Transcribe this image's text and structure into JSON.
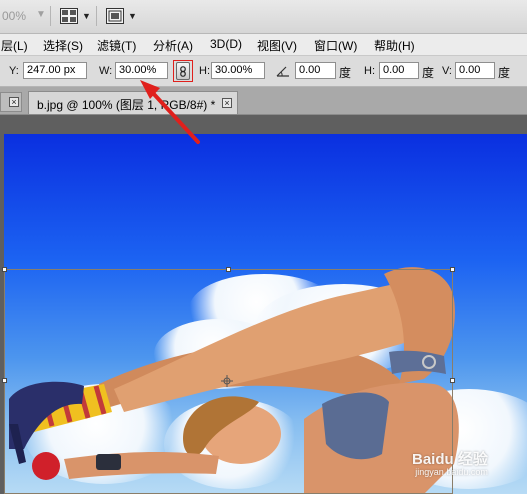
{
  "toolbar": {
    "zoom_value": "00%",
    "arrange_icon": "arrange-documents-icon",
    "screen_mode_icon": "screen-mode-icon"
  },
  "menu": {
    "items": [
      "层(L)",
      "选择(S)",
      "滤镜(T)",
      "分析(A)",
      "3D(D)",
      "视图(V)",
      "窗口(W)",
      "帮助(H)"
    ]
  },
  "options": {
    "y_label": "Y:",
    "y_value": "247.00 px",
    "w_label": "W:",
    "w_value": "30.00%",
    "h_label": "H:",
    "h_value": "30.00%",
    "angle_value": "0.00",
    "angle_unit": "度",
    "hskew_label": "H:",
    "hskew_value": "0.00",
    "hskew_unit": "度",
    "vskew_label": "V:",
    "vskew_value": "0.00",
    "vskew_unit": "度",
    "link_icon": "link-aspect-ratio-icon"
  },
  "tabs": {
    "active_title": "b.jpg @ 100% (图层 1, RGB/8#) *"
  },
  "annotation": {
    "arrow_color": "#e0201c",
    "highlight_color": "#e0201c"
  },
  "watermark": {
    "brand": "Baidu 经验",
    "sub": "jingyan.baidu.com"
  },
  "colors": {
    "sky_top": "#0a2fe0",
    "sky_bottom": "#b7dbf5",
    "selection_border": "#8a7e6a"
  }
}
